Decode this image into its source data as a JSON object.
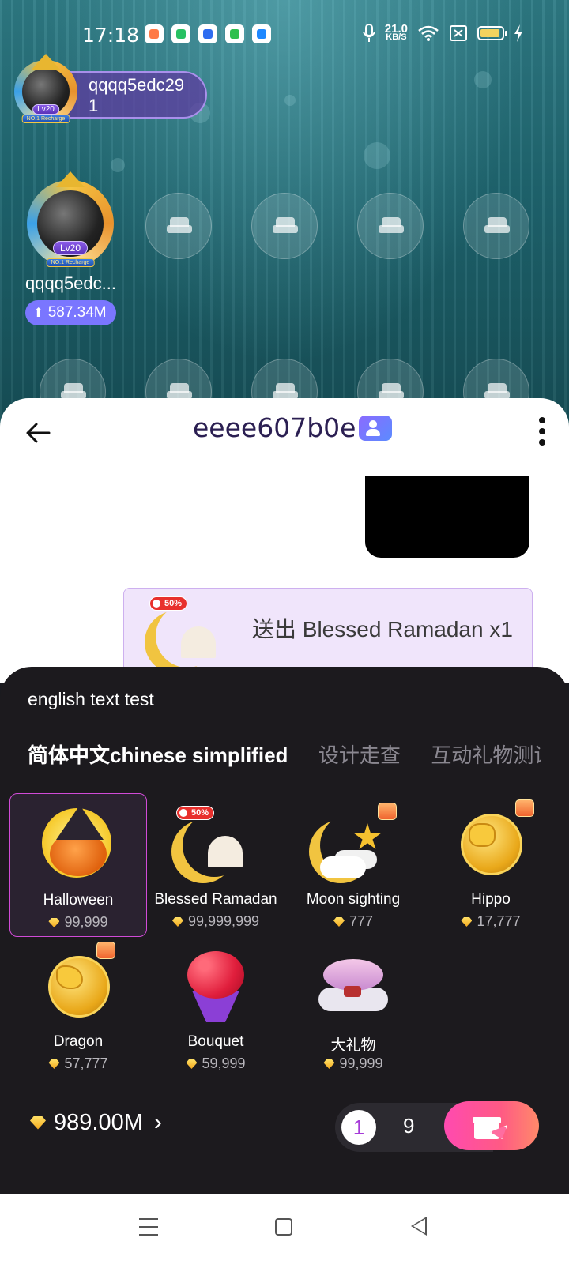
{
  "status_bar": {
    "time": "17:18",
    "net_speed_value": "21.0",
    "net_speed_unit": "KB/S",
    "icons": [
      "game-app-icon",
      "shield-app-icon",
      "baidu-app-icon",
      "grid-app-icon",
      "browser-app-icon",
      "mic-icon",
      "wifi-icon",
      "sim-off-icon",
      "battery-icon",
      "charging-icon"
    ]
  },
  "room": {
    "host_pill_name": "qqqq5edc29",
    "host_pill_count": "1",
    "host_seat_name": "qqqq5edc...",
    "host_seat_score": "587.34M",
    "level_badge": "Lv20",
    "rank_ribbon": "NO.1 Recharge"
  },
  "chat": {
    "title": "eeee607b0e",
    "gift_message": "送出 Blessed Ramadan x1",
    "gift_message_badge": "50%"
  },
  "gift_panel": {
    "note": "english text test",
    "tabs": [
      {
        "label": "简体中文chinese simplified",
        "active": true
      },
      {
        "label": "设计走查",
        "active": false
      },
      {
        "label": "互动礼物测试",
        "active": false
      }
    ],
    "gifts": [
      {
        "name": "Halloween",
        "price": "99,999",
        "selected": true
      },
      {
        "name": "Blessed Ramadan",
        "price": "99,999,999",
        "badge": "50%"
      },
      {
        "name": "Moon sighting",
        "price": "777"
      },
      {
        "name": "Hippo",
        "price": "17,777"
      },
      {
        "name": "Dragon",
        "price": "57,777"
      },
      {
        "name": "Bouquet",
        "price": "59,999"
      },
      {
        "name": "大礼物",
        "price": "99,999"
      }
    ],
    "balance": "989.00M",
    "quantity_selected": "1",
    "quantity_option": "9"
  },
  "colors": {
    "accent": "#d14bd8",
    "send_gradient_start": "#ff4ab0",
    "send_gradient_end": "#ff8a6a",
    "room_bg": "#1f6670",
    "panel_bg": "#1c1a1e"
  }
}
